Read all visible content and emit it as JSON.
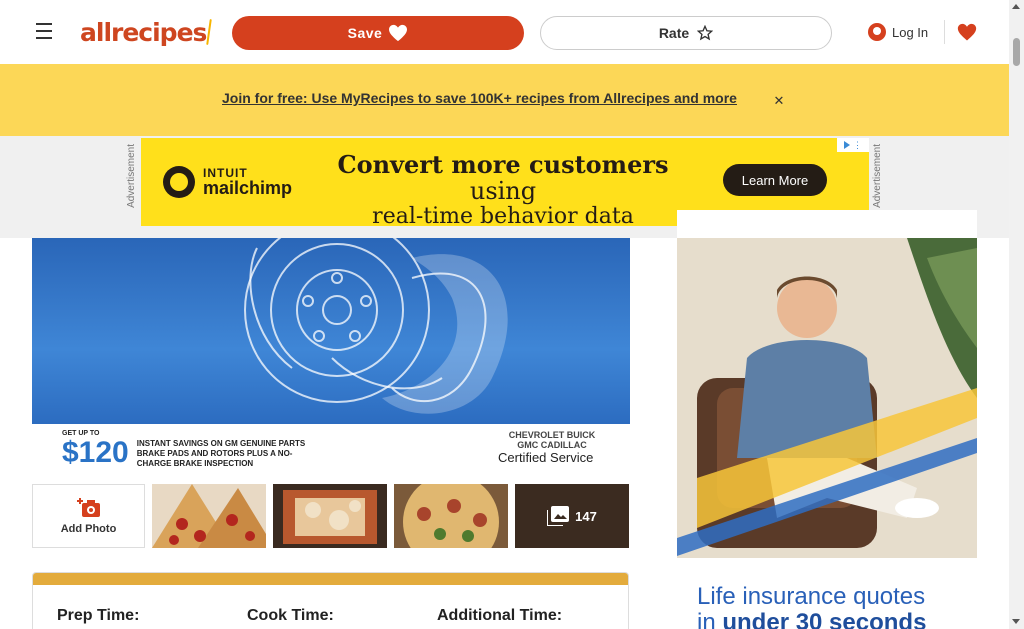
{
  "header": {
    "logo_text": "allrecipes",
    "save_label": "Save",
    "rate_label": "Rate",
    "login_label": "Log In"
  },
  "promo": {
    "link_text": "Join for free: Use MyRecipes to save 100K+ recipes from Allrecipes and more",
    "close_glyph": "✕"
  },
  "ads": {
    "label": "Advertisement",
    "banner": {
      "brand_top": "INTUIT",
      "brand_name": "mailchimp",
      "headline_bold": "Convert more customers",
      "headline_rest": " using",
      "headline_line2": "real-time behavior data",
      "cta": "Learn More"
    },
    "hero": {
      "get_up_to": "GET UP TO",
      "amount": "$120",
      "description": "INSTANT SAVINGS ON GM GENUINE PARTS BRAKE PADS AND ROTORS PLUS A NO-CHARGE BRAKE INSPECTION",
      "brands": "CHEVROLET  BUICK  GMC  CADILLAC",
      "certified": "Certified Service"
    },
    "sidebar": {
      "text_line1": "Life insurance quotes",
      "text_line2_prefix": "in ",
      "text_line2_bold": "under 30 seconds"
    }
  },
  "photos": {
    "add_label": "Add Photo",
    "more_count": "147"
  },
  "details": {
    "prep_label": "Prep Time:",
    "cook_label": "Cook Time:",
    "additional_label": "Additional Time:"
  },
  "colors": {
    "brand": "#d5401e",
    "promo_bg": "#fcd757",
    "mailchimp_yellow": "#ffe01b",
    "detail_accent": "#e3ab3c"
  }
}
